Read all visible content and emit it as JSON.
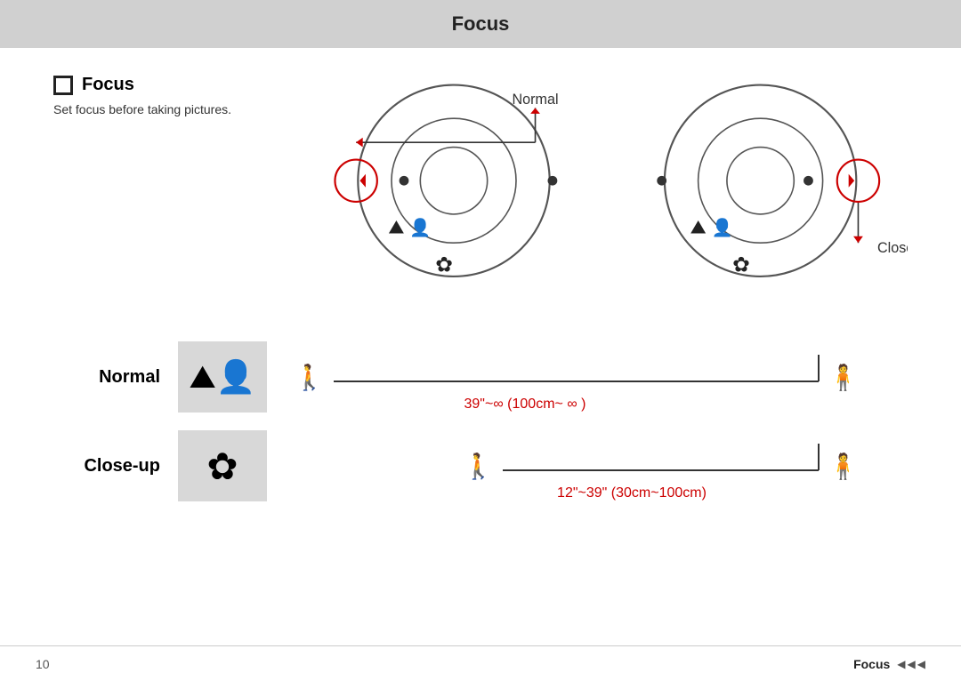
{
  "header": {
    "title": "Focus"
  },
  "focus_info": {
    "title": "Focus",
    "description": "Set focus before taking pictures."
  },
  "labels": {
    "normal": "Normal",
    "closeup": "Close-up",
    "normal_range": "39\"~∞ (100cm~ ∞ )",
    "closeup_range": "12\"~39\" (30cm~100cm)"
  },
  "footer": {
    "page": "10",
    "section": "Focus"
  },
  "colors": {
    "red": "#cc0000",
    "gray_bg": "#d0d0d0",
    "icon_box_bg": "#d8d8d8"
  }
}
